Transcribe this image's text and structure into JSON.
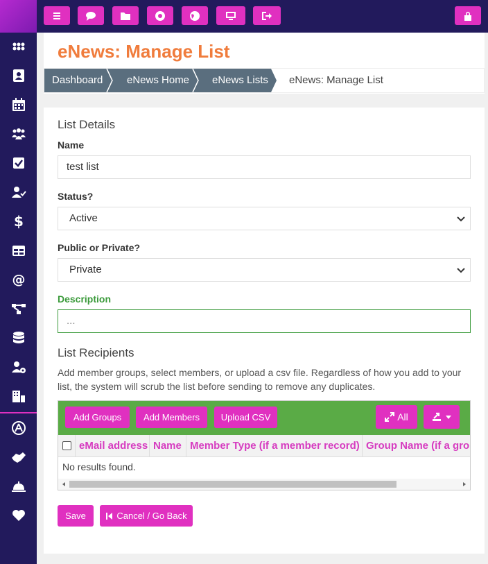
{
  "topbar": {
    "buttons": [
      {
        "icon": "menu-icon"
      },
      {
        "icon": "chat-icon"
      },
      {
        "icon": "folder-icon"
      },
      {
        "icon": "lifebuoy-icon"
      },
      {
        "icon": "globe-icon"
      },
      {
        "icon": "monitor-icon"
      },
      {
        "icon": "sign-out-icon"
      },
      {
        "icon": "lock-icon"
      }
    ]
  },
  "sidebar": {
    "items": [
      {
        "icon": "grid-icon"
      },
      {
        "icon": "contact-card-icon"
      },
      {
        "icon": "calendar-icon"
      },
      {
        "icon": "users-icon"
      },
      {
        "icon": "checkbox-icon"
      },
      {
        "icon": "user-check-icon"
      },
      {
        "icon": "dollar-icon"
      },
      {
        "icon": "table-icon"
      },
      {
        "icon": "at-icon"
      },
      {
        "icon": "flow-icon"
      },
      {
        "icon": "database-icon"
      },
      {
        "icon": "user-gear-icon"
      },
      {
        "icon": "building-icon"
      },
      {
        "icon": "app-store-icon"
      },
      {
        "icon": "handshake-icon"
      },
      {
        "icon": "bell-icon"
      },
      {
        "icon": "heart-icon"
      }
    ]
  },
  "page": {
    "title": "eNews: Manage List",
    "breadcrumb": [
      "Dashboard",
      "eNews Home",
      "eNews Lists",
      "eNews: Manage List"
    ]
  },
  "form": {
    "section_title": "List Details",
    "name_label": "Name",
    "name_value": "test list",
    "status_label": "Status?",
    "status_value": "Active",
    "visibility_label": "Public or Private?",
    "visibility_value": "Private",
    "description_label": "Description",
    "description_placeholder": "...",
    "recipients_title": "List Recipients",
    "recipients_help": "Add member groups, select members, or upload a csv file. Regardless of how you add to your list, the system will scrub the list before sending to remove any duplicates."
  },
  "grid": {
    "add_groups": "Add Groups",
    "add_members": "Add Members",
    "upload_csv": "Upload CSV",
    "all": "All",
    "columns": [
      "eMail address",
      "Name",
      "Member Type (if a member record)",
      "Group Name (if a grou"
    ],
    "empty": "No results found."
  },
  "actions": {
    "save": "Save",
    "cancel": "Cancel / Go Back"
  },
  "colors": {
    "accent": "#e030c0",
    "nav": "#221a5c",
    "title": "#f07c3c",
    "grid_toolbar": "#5aab46"
  }
}
